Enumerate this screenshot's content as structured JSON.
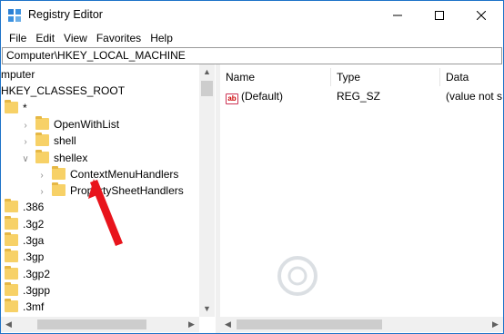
{
  "window": {
    "title": "Registry Editor"
  },
  "menu": [
    "File",
    "Edit",
    "View",
    "Favorites",
    "Help"
  ],
  "address": "Computer\\HKEY_LOCAL_MACHINE",
  "tree": [
    {
      "label": "mputer",
      "indent": 0,
      "expander": "",
      "folder": false
    },
    {
      "label": "HKEY_CLASSES_ROOT",
      "indent": 0,
      "expander": "",
      "folder": false
    },
    {
      "label": "*",
      "indent": 1,
      "expander": "",
      "folder": true
    },
    {
      "label": "OpenWithList",
      "indent": 2,
      "expander": ">",
      "folder": true
    },
    {
      "label": "shell",
      "indent": 2,
      "expander": ">",
      "folder": true
    },
    {
      "label": "shellex",
      "indent": 2,
      "expander": "v",
      "folder": true
    },
    {
      "label": "ContextMenuHandlers",
      "indent": 3,
      "expander": ">",
      "folder": true
    },
    {
      "label": "PropertySheetHandlers",
      "indent": 3,
      "expander": ">",
      "folder": true
    },
    {
      "label": ".386",
      "indent": 1,
      "expander": "",
      "folder": true
    },
    {
      "label": ".3g2",
      "indent": 1,
      "expander": "",
      "folder": true
    },
    {
      "label": ".3ga",
      "indent": 1,
      "expander": "",
      "folder": true
    },
    {
      "label": ".3gp",
      "indent": 1,
      "expander": "",
      "folder": true
    },
    {
      "label": ".3gp2",
      "indent": 1,
      "expander": "",
      "folder": true
    },
    {
      "label": ".3gpp",
      "indent": 1,
      "expander": "",
      "folder": true
    },
    {
      "label": ".3mf",
      "indent": 1,
      "expander": "",
      "folder": true
    }
  ],
  "list": {
    "columns": [
      "Name",
      "Type",
      "Data"
    ],
    "rows": [
      {
        "name": "(Default)",
        "type": "REG_SZ",
        "data": "(value not s"
      }
    ]
  },
  "icons": {
    "app": "registry-editor-icon",
    "value": "string-value-icon",
    "folder": "folder-icon",
    "annotation": "red-arrow-icon"
  },
  "colors": {
    "arrow": "#e8141c",
    "folder": "#f7d167",
    "window_border": "#1e73c8"
  }
}
